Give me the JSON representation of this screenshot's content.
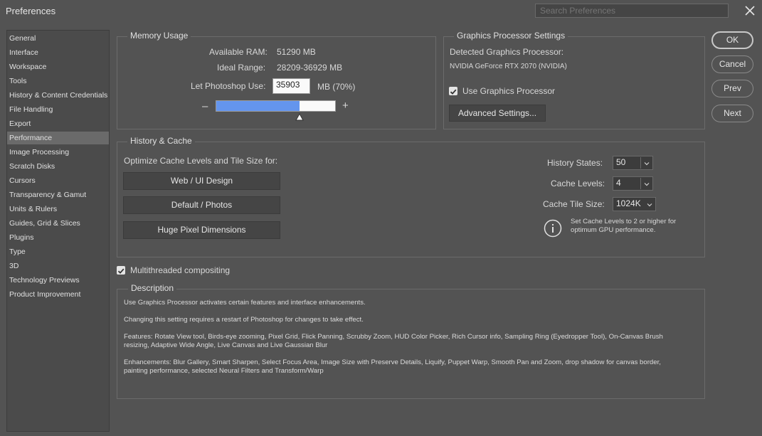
{
  "window": {
    "title": "Preferences",
    "search_placeholder": "Search Preferences"
  },
  "sidebar": {
    "items": [
      {
        "label": "General"
      },
      {
        "label": "Interface"
      },
      {
        "label": "Workspace"
      },
      {
        "label": "Tools"
      },
      {
        "label": "History & Content Credentials"
      },
      {
        "label": "File Handling"
      },
      {
        "label": "Export"
      },
      {
        "label": "Performance",
        "selected": true
      },
      {
        "label": "Image Processing"
      },
      {
        "label": "Scratch Disks"
      },
      {
        "label": "Cursors"
      },
      {
        "label": "Transparency & Gamut"
      },
      {
        "label": "Units & Rulers"
      },
      {
        "label": "Guides, Grid & Slices"
      },
      {
        "label": "Plugins"
      },
      {
        "label": "Type"
      },
      {
        "label": "3D"
      },
      {
        "label": "Technology Previews"
      },
      {
        "label": "Product Improvement"
      }
    ]
  },
  "memory": {
    "legend": "Memory Usage",
    "available_label": "Available RAM:",
    "available_value": "51290 MB",
    "ideal_label": "Ideal Range:",
    "ideal_value": "28209-36929 MB",
    "use_label": "Let Photoshop Use:",
    "use_value": "35903",
    "use_unit": "MB (70%)",
    "slider_fraction": 0.7,
    "minus": "–",
    "plus": "+"
  },
  "gpu": {
    "legend": "Graphics Processor Settings",
    "detected_label": "Detected Graphics Processor:",
    "detected_value": "NVIDIA GeForce RTX 2070 (NVIDIA)",
    "use_label": "Use Graphics Processor",
    "use_checked": true,
    "advanced_button": "Advanced Settings..."
  },
  "history_cache": {
    "legend": "History & Cache",
    "optimize_label": "Optimize Cache Levels and Tile Size for:",
    "buttons": [
      "Web / UI Design",
      "Default / Photos",
      "Huge Pixel Dimensions"
    ],
    "history_states_label": "History States:",
    "history_states_value": "50",
    "cache_levels_label": "Cache Levels:",
    "cache_levels_value": "4",
    "tile_size_label": "Cache Tile Size:",
    "tile_size_value": "1024K",
    "info_line1": "Set Cache Levels to 2 or higher for",
    "info_line2": "optimum GPU performance."
  },
  "multithreaded": {
    "label": "Multithreaded compositing",
    "checked": true
  },
  "description": {
    "legend": "Description",
    "p1": "Use Graphics Processor activates certain features and interface enhancements.",
    "p2": "Changing this setting requires a restart of Photoshop for changes to take effect.",
    "p3a": "Features: Rotate View tool, Birds-eye zooming, Pixel Grid, Flick Panning, Scrubby Zoom, HUD Color Picker, Rich Cursor info, Sampling Ring (Eyedropper Tool), On-Canvas Brush",
    "p3b": "resizing, Adaptive Wide Angle, Live Canvas and Live Gaussian Blur",
    "p4a": "Enhancements: Blur Gallery, Smart Sharpen, Select Focus Area, Image Size with Preserve Details, Liquify, Puppet Warp, Smooth Pan and Zoom, drop shadow for canvas border,",
    "p4b": "painting performance, selected Neural Filters and Transform/Warp"
  },
  "actions": {
    "ok": "OK",
    "cancel": "Cancel",
    "prev": "Prev",
    "next": "Next"
  },
  "colors": {
    "background": "#535353",
    "slider_fill": "#6495ed",
    "selected_item": "#6a6a6a"
  }
}
